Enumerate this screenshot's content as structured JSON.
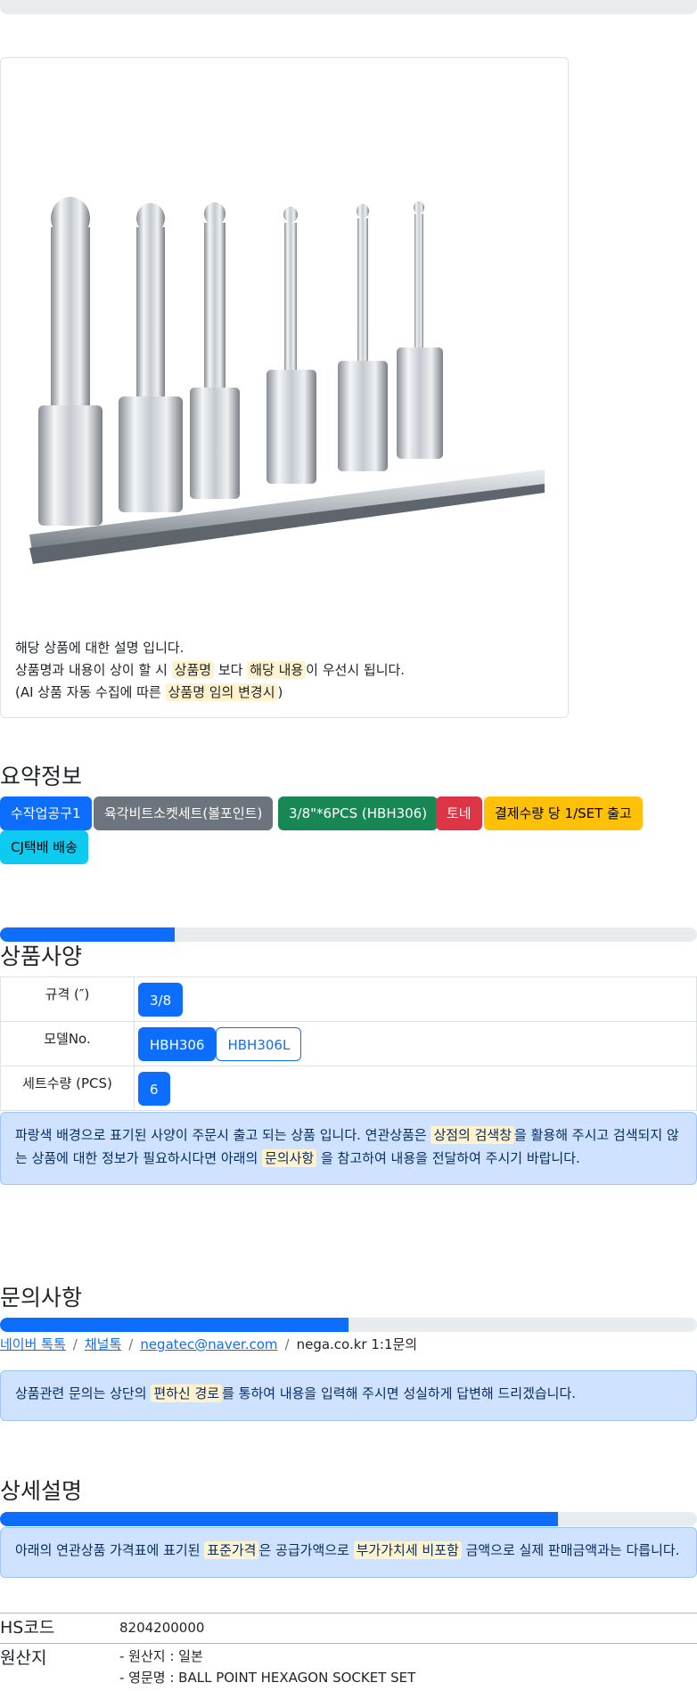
{
  "product": {
    "description": {
      "line1": "해당 상품에 대한 설명 입니다.",
      "line2_a": "상품명과 내용이 상이 할 시 ",
      "line2_hl1": "상품명",
      "line2_b": " 보다 ",
      "line2_hl2": "해당 내용",
      "line2_c": "이 우선시 됩니다.",
      "line3_a": "(AI 상품 자동 수집에 따른 ",
      "line3_hl": "상품명 임의 변경시",
      "line3_b": ")"
    }
  },
  "summary": {
    "title": "요약정보",
    "badges": [
      {
        "label": "수작업공구1",
        "color": "#0d6efd",
        "text_color": "#ffffff"
      },
      {
        "label": "육각비트소켓세트(볼포인트)",
        "color": "#6c757d",
        "text_color": "#ffffff"
      },
      {
        "label": "3/8\"*6PCS (HBH306)",
        "color": "#198754",
        "text_color": "#ffffff"
      },
      {
        "label": "토네",
        "color": "#dc3545",
        "text_color": "#ffffff"
      },
      {
        "label": "결제수량 당 1/SET 출고",
        "color": "#ffc107",
        "text_color": "#000000"
      },
      {
        "label": "CJ택배 배송",
        "color": "#0dcaf0",
        "text_color": "#000000"
      }
    ]
  },
  "specs": {
    "title": "상품사양",
    "progress": 0.25,
    "rows": [
      {
        "label": "규격 (″)",
        "options": [
          {
            "text": "3/8",
            "active": true
          }
        ]
      },
      {
        "label": "모델No.",
        "options": [
          {
            "text": "HBH306",
            "active": true
          },
          {
            "text": "HBH306L",
            "active": false
          }
        ]
      },
      {
        "label": "세트수량 (PCS)",
        "options": [
          {
            "text": "6",
            "active": true
          }
        ]
      }
    ],
    "notice": {
      "a": "파랑색 배경으로 표기된 사양이 주문시 출고 되는 상품 입니다. 연관상품은 ",
      "hl1": "상점의 검색창",
      "b": "을 활용해 주시고 검색되지 않는 상품에 대한 정보가 필요하시다면 아래의 ",
      "hl2": "문의사항",
      "c": " 을 참고하여 내용을 전달하여 주시기 바랍니다."
    }
  },
  "inquiry": {
    "title": "문의사항",
    "progress": 0.5,
    "links": [
      "네이버 톡톡",
      "채널톡",
      "negatec@naver.com"
    ],
    "last": "nega.co.kr 1:1문의",
    "separator": "/",
    "notice": {
      "a": "상품관련 문의는 상단의 ",
      "hl": "편하신 경로",
      "b": "를 통하여 내용을 입력해 주시면 성실하게 답변해 드리겠습니다."
    }
  },
  "detail": {
    "title": "상세설명",
    "progress": 0.8,
    "notice": {
      "a": "아래의 연관상품 가격표에 표기된 ",
      "hl1": "표준가격",
      "b": "은 공급가액으로 ",
      "hl2": "부가가치세 비포함",
      "c": " 금액으로 실제 판매금액과는 다릅니다."
    },
    "hs_code_label": "HS코드",
    "hs_code_value": "8204200000",
    "origin_label": "원산지",
    "origin_line1": "- 원산지 : 일본",
    "origin_line2": "- 영문명 : BALL POINT HEXAGON SOCKET SET"
  }
}
